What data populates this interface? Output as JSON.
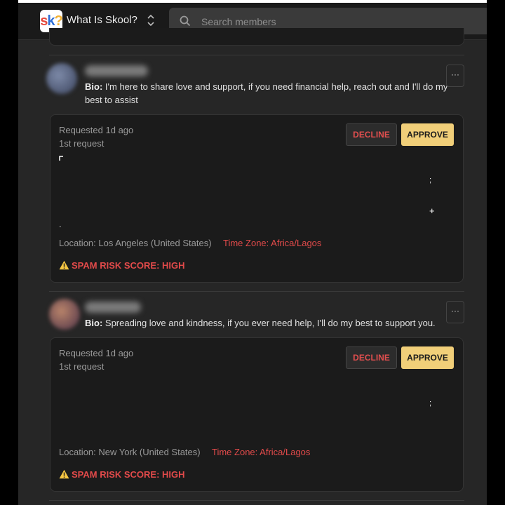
{
  "header": {
    "logo_letters": [
      "s",
      "k",
      "?"
    ],
    "group_name": "What Is Skool?",
    "search_placeholder": "Search members"
  },
  "requests": [
    {
      "bio_label": "Bio:",
      "bio_line1": "I'm here to share love and support, if you need financial help, reach out and I'll do my",
      "bio_line2": "best to assist",
      "more_label": "···",
      "requested": "Requested 1d ago",
      "request_count": "1st request",
      "decline_label": "DECLINE",
      "approve_label": "APPROVE",
      "location": "Location: Los Angeles (United States)",
      "timezone": "Time Zone: Africa/Lagos",
      "spam": "SPAM RISK SCORE: HIGH"
    },
    {
      "bio_label": "Bio:",
      "bio_line1": "Spreading love and kindness, if you ever need help, I'll do my best to support you.",
      "more_label": "···",
      "requested": "Requested 1d ago",
      "request_count": "1st request",
      "decline_label": "DECLINE",
      "approve_label": "APPROVE",
      "location": "Location: New York (United States)",
      "timezone": "Time Zone: Africa/Lagos",
      "spam": "SPAM RISK SCORE: HIGH"
    }
  ],
  "colors": {
    "accent_approve": "#f1cf79",
    "danger": "#e14a4a",
    "background": "#262626",
    "card": "#1b1b1b"
  },
  "icons": [
    "search-icon",
    "chevron-updown-icon",
    "more-icon",
    "warning-icon"
  ]
}
